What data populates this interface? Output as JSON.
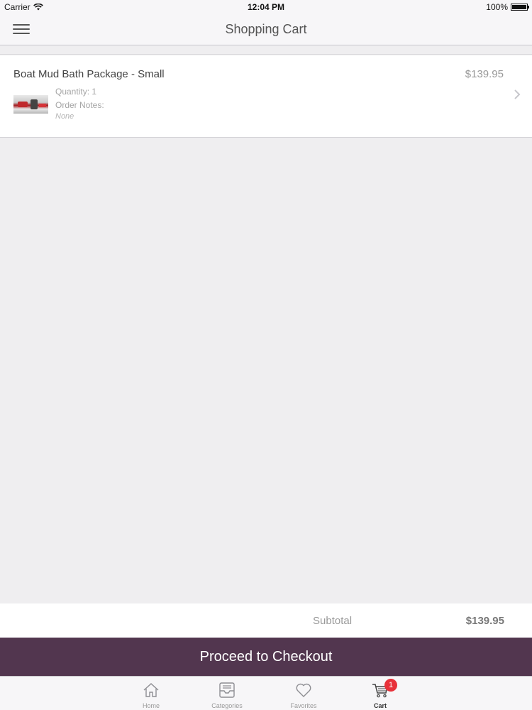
{
  "status_bar": {
    "carrier": "Carrier",
    "time": "12:04 PM",
    "battery": "100%"
  },
  "nav": {
    "title": "Shopping Cart"
  },
  "cart": {
    "items": [
      {
        "name": "Boat Mud Bath Package - Small",
        "price": "$139.95",
        "quantity": "Quantity: 1",
        "notes_label": "Order Notes:",
        "notes_value": "None"
      }
    ],
    "subtotal_label": "Subtotal",
    "subtotal_value": "$139.95"
  },
  "checkout": {
    "label": "Proceed to Checkout"
  },
  "tabs": [
    {
      "label": "Home",
      "icon": "home-icon"
    },
    {
      "label": "Categories",
      "icon": "inbox-icon"
    },
    {
      "label": "Favorites",
      "icon": "heart-icon"
    },
    {
      "label": "Cart",
      "icon": "cart-icon",
      "badge": "1"
    }
  ],
  "colors": {
    "accent": "#52364f",
    "badge": "#e8313a"
  }
}
